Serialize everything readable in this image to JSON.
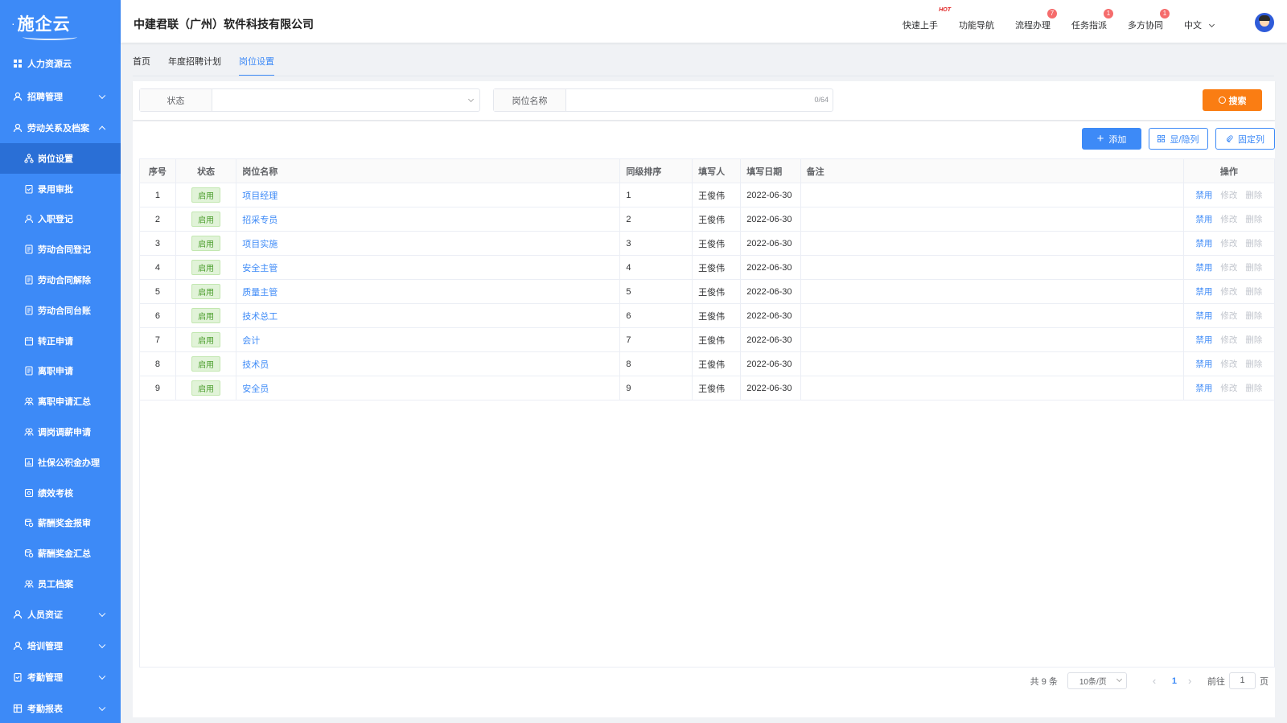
{
  "sidebar": {
    "logo": "施企云",
    "top_item": "人力资源云",
    "groups": [
      {
        "label": "招聘管理"
      },
      {
        "label": "劳动关系及档案"
      }
    ],
    "sub_items": [
      {
        "label": "岗位设置",
        "icon": "hierarchy-icon"
      },
      {
        "label": "录用审批",
        "icon": "clipboard-check-icon"
      },
      {
        "label": "入职登记",
        "icon": "user-icon"
      },
      {
        "label": "劳动合同登记",
        "icon": "document-icon"
      },
      {
        "label": "劳动合同解除",
        "icon": "document-icon"
      },
      {
        "label": "劳动合同台账",
        "icon": "document-icon"
      },
      {
        "label": "转正申请",
        "icon": "calendar-icon"
      },
      {
        "label": "离职申请",
        "icon": "document-icon"
      },
      {
        "label": "离职申请汇总",
        "icon": "users-icon"
      },
      {
        "label": "调岗调薪申请",
        "icon": "users-icon"
      },
      {
        "label": "社保公积金办理",
        "icon": "chart-icon"
      },
      {
        "label": "绩效考核",
        "icon": "eye-icon"
      },
      {
        "label": "薪酬奖金报审",
        "icon": "coins-icon"
      },
      {
        "label": "薪酬奖金汇总",
        "icon": "coins-icon"
      },
      {
        "label": "员工档案",
        "icon": "users-icon"
      }
    ],
    "bottom_groups": [
      {
        "label": "人员资证"
      },
      {
        "label": "培训管理"
      },
      {
        "label": "考勤管理"
      },
      {
        "label": "考勤报表"
      }
    ]
  },
  "header": {
    "company": "中建君联（广州）软件科技有限公司",
    "nav": [
      {
        "label": "快速上手",
        "hot": "HOT"
      },
      {
        "label": "功能导航"
      },
      {
        "label": "流程办理",
        "badge": "7"
      },
      {
        "label": "任务指派",
        "badge": "1"
      },
      {
        "label": "多方协同",
        "badge": "1"
      }
    ],
    "language": "中文"
  },
  "tabs": [
    "首页",
    "年度招聘计划",
    "岗位设置"
  ],
  "filter": {
    "status_label": "状态",
    "status_value": "",
    "name_label": "岗位名称",
    "name_value": "",
    "name_count": "0/64",
    "search_label": "搜索"
  },
  "toolbar": {
    "add_label": "添加",
    "toggle_label": "显/隐列",
    "pin_label": "固定列"
  },
  "table": {
    "columns": [
      "序号",
      "状态",
      "岗位名称",
      "同级排序",
      "填写人",
      "填写日期",
      "备注",
      "操作"
    ],
    "rows": [
      {
        "no": "1",
        "status": "启用",
        "name": "项目经理",
        "order": "1",
        "author": "王俊伟",
        "date": "2022-06-30",
        "note": ""
      },
      {
        "no": "2",
        "status": "启用",
        "name": "招采专员",
        "order": "2",
        "author": "王俊伟",
        "date": "2022-06-30",
        "note": ""
      },
      {
        "no": "3",
        "status": "启用",
        "name": "项目实施",
        "order": "3",
        "author": "王俊伟",
        "date": "2022-06-30",
        "note": ""
      },
      {
        "no": "4",
        "status": "启用",
        "name": "安全主管",
        "order": "4",
        "author": "王俊伟",
        "date": "2022-06-30",
        "note": ""
      },
      {
        "no": "5",
        "status": "启用",
        "name": "质量主管",
        "order": "5",
        "author": "王俊伟",
        "date": "2022-06-30",
        "note": ""
      },
      {
        "no": "6",
        "status": "启用",
        "name": "技术总工",
        "order": "6",
        "author": "王俊伟",
        "date": "2022-06-30",
        "note": ""
      },
      {
        "no": "7",
        "status": "启用",
        "name": "会计",
        "order": "7",
        "author": "王俊伟",
        "date": "2022-06-30",
        "note": ""
      },
      {
        "no": "8",
        "status": "启用",
        "name": "技术员",
        "order": "8",
        "author": "王俊伟",
        "date": "2022-06-30",
        "note": ""
      },
      {
        "no": "9",
        "status": "启用",
        "name": "安全员",
        "order": "9",
        "author": "王俊伟",
        "date": "2022-06-30",
        "note": ""
      }
    ],
    "actions": [
      "禁用",
      "修改",
      "删除"
    ]
  },
  "pagination": {
    "total": "共 9 条",
    "page_size": "10条/页",
    "current": "1",
    "goto_label": "前往",
    "goto_value": "1",
    "page_unit": "页"
  },
  "colors": {
    "sidebar": "#3d8af7",
    "sidebar_active": "#2a6fd6",
    "accent": "#3d8af7",
    "search": "#fa7d13",
    "badge": "#f56c6c"
  }
}
